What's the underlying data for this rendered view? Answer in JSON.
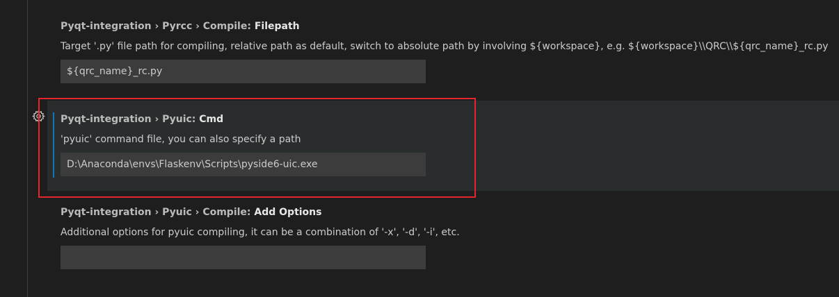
{
  "settings": [
    {
      "category": "Pyqt-integration › Pyrcc › Compile: ",
      "key": "Filepath",
      "description": "Target '.py' file path for compiling, relative path as default, switch to absolute path by involving ${workspace}, e.g. ${workspace}\\\\QRC\\\\${qrc_name}_rc.py",
      "value": "${qrc_name}_rc.py"
    },
    {
      "category": "Pyqt-integration › Pyuic: ",
      "key": "Cmd",
      "description": "'pyuic' command file, you can also specify a path",
      "value": "D:\\Anaconda\\envs\\Flaskenv\\Scripts\\pyside6-uic.exe"
    },
    {
      "category": "Pyqt-integration › Pyuic › Compile: ",
      "key": "Add Options",
      "description": "Additional options for pyuic compiling, it can be a combination of '-x', '-d', '-i', etc.",
      "value": ""
    }
  ],
  "icons": {
    "settings_gear": "gear-icon"
  },
  "colors": {
    "background": "#1e1e1e",
    "focused_row": "#2a2d2e",
    "focus_indicator": "#1177bb",
    "input_background": "#3c3c3c",
    "highlight_box": "#e5252a"
  }
}
